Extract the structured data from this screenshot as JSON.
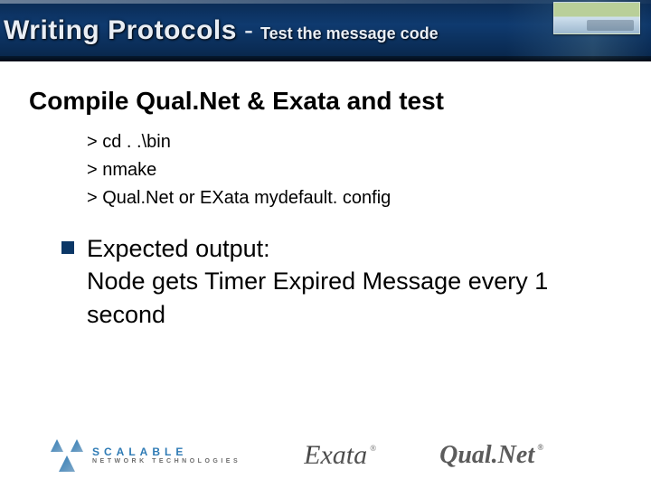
{
  "header": {
    "title_main": "Writing Protocols",
    "title_dash": "-",
    "title_sub": "Test the message code"
  },
  "body": {
    "heading": "Compile Qual.Net & Exata and test",
    "commands": [
      "> cd . .\\bin",
      "> nmake",
      "> Qual.Net or EXata mydefault. config"
    ],
    "bullet": "Expected output:\nNode gets Timer Expired Message every 1 second"
  },
  "footer": {
    "scalable_line1": "SCALABLE",
    "scalable_line2": "NETWORK TECHNOLOGIES",
    "exata": "Exata",
    "qualnet": "Qual.Net"
  }
}
